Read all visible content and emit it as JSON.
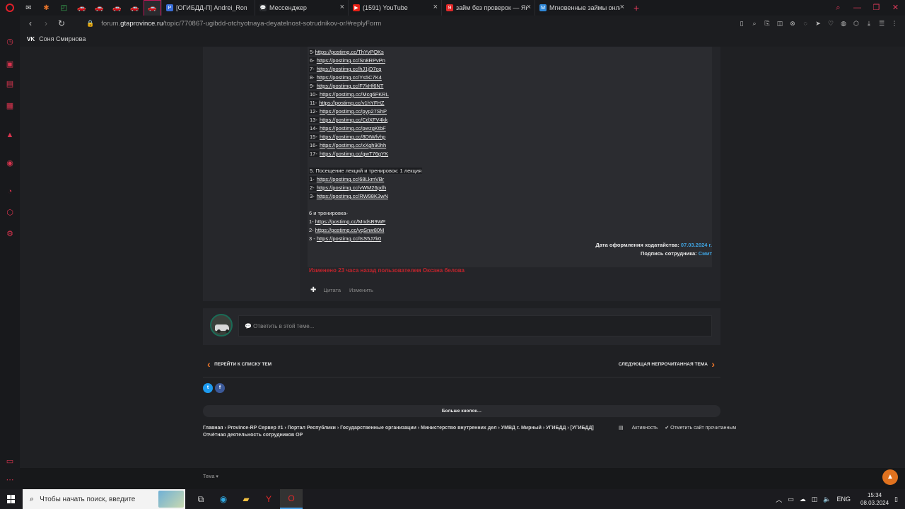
{
  "browser": {
    "tabs": [
      {
        "label": "[ОГИБДД-П] Andrei_Roma",
        "fav": "#3a6ed8",
        "fav_text": "P"
      },
      {
        "label": "Мессенджер",
        "fav": "#2b2d31",
        "fav_text": "💬"
      },
      {
        "label": "(1591) YouTube",
        "fav": "#e62117",
        "fav_text": "▶"
      },
      {
        "label": "займ без проверок — Янд",
        "fav": "#e2292a",
        "fav_text": "Я"
      },
      {
        "label": "Мгновенные займы онлай",
        "fav": "#2f88d8",
        "fav_text": "M"
      }
    ],
    "new_tab": "+",
    "url_prefix": "forum.",
    "url_domain": "gtaprovince.ru",
    "url_path": "/topic/770867-ugibdd-otchyotnaya-deyatelnost-sotrudnikov-or/#replyForm",
    "bookmark": "Соня Смирнова"
  },
  "post": {
    "lines": [
      {
        "num": " 5-",
        "link": "https://postimg.cc/ThYvPQKs"
      },
      {
        "num": " 6- ",
        "link": "https://postimg.cc/Sn8RPvPn"
      },
      {
        "num": " 7- ",
        "link": "https://postimg.cc/hJ1jD7cg"
      },
      {
        "num": " 8- ",
        "link": "https://postimg.cc/Ys5C7K4"
      },
      {
        "num": " 9- ",
        "link": "https://postimg.cc/F7kHf6NT"
      },
      {
        "num": " 10- ",
        "link": "https://postimg.cc/Mcg6FKRL"
      },
      {
        "num": " 11- ",
        "link": "https://postimg.cc/v1hYFHZ"
      },
      {
        "num": "12- ",
        "link": "https://postimg.cc/pyp27ShP"
      },
      {
        "num": " 13- ",
        "link": "https://postimg.cc/CdXFV4kk"
      },
      {
        "num": "14- ",
        "link": "https://postimg.cc/pwzgKtbF"
      },
      {
        "num": "15- ",
        "link": "https://postimg.cc/8DtWfvhp"
      },
      {
        "num": "16- ",
        "link": "https://postimg.cc/xXgh90hh"
      },
      {
        "num": "17- ",
        "link": "https://postimg.cc/gwT76gYK"
      }
    ],
    "section5_title": "5. Посещение лекций и тренировок: 1 лекция",
    "section5": [
      {
        "num": "1- ",
        "link": "https://postimg.cc/68LkmVBr"
      },
      {
        "num": "2- ",
        "link": "https://postimg.cc/vWM26pdh"
      },
      {
        "num": " 3- ",
        "link": "https://postimg.cc/RW98K3wN"
      }
    ],
    "section6_title": "6 и тренировка-",
    "section6": [
      {
        "num": "1- ",
        "link": "https://postimg.cc/MndsB9WF"
      },
      {
        "num": "2- ",
        "link": "https://postimg.cc/yqSnw80M"
      },
      {
        "num": "3 - ",
        "link": "https://postimg.cc/tsS5J7k0"
      }
    ],
    "date_label": "Дата оформления ходатайства: ",
    "date_value": "07.03.2024 г.",
    "sign_label": "Подпись сотрудника: ",
    "sign_value": "Смит",
    "edited": "Изменено 23 часа назад пользователем Оксана белова",
    "action_plus": "✚",
    "action_quote": "Цитата",
    "action_edit": "Изменить"
  },
  "reply": {
    "placeholder": "💬 Ответить в этой теме..."
  },
  "pager": {
    "prev": "ПЕРЕЙТИ К СПИСКУ ТЕМ",
    "next": "СЛЕДУЮЩАЯ НЕПРОЧИТАННАЯ ТЕМА"
  },
  "more_buttons": "Больше кнопок…",
  "breadcrumb": "Главная  ›  Province-RP Сервер #1  ›  Портал Республики  ›  Государственные организации  ›  Министерство внутренних дел  ›  УМВД г. Мирный  ›  УГИБДД  ›  [УГИБДД] Отчётная деятельность сотрудников ОР",
  "activity": "Активность",
  "mark_read": "✔ Отметить сайт прочитанным",
  "footer_theme": "Тема ▾",
  "taskbar": {
    "search": "Чтобы начать поиск, введите",
    "lang": "ENG",
    "time": "15:34",
    "date": "08.03.2024"
  }
}
